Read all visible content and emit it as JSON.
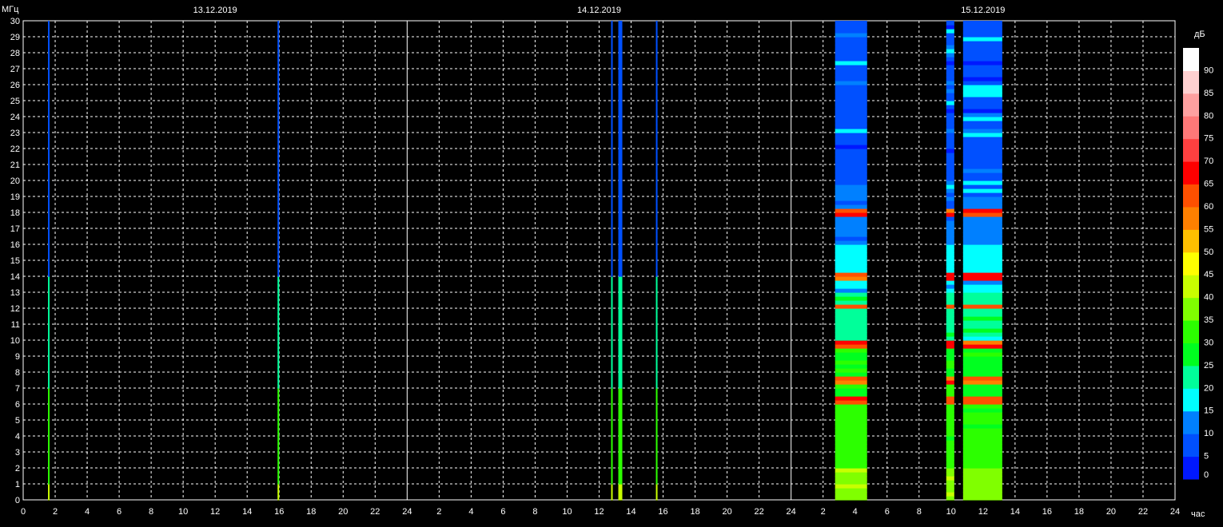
{
  "chart_data": {
    "type": "heatmap",
    "y_unit": "МГц",
    "x_unit": "час",
    "scale_unit": "дБ",
    "ylim": [
      0,
      30
    ],
    "xlim_hours": [
      0,
      72
    ],
    "dates": [
      "13.12.2019",
      "14.12.2019",
      "15.12.2019"
    ],
    "y_ticks": [
      0,
      1,
      2,
      3,
      4,
      5,
      6,
      7,
      8,
      9,
      10,
      11,
      12,
      13,
      14,
      15,
      16,
      17,
      18,
      19,
      20,
      21,
      22,
      23,
      24,
      25,
      26,
      27,
      28,
      29,
      30
    ],
    "x_tick_labels": [
      "0",
      "2",
      "4",
      "6",
      "8",
      "10",
      "12",
      "14",
      "16",
      "18",
      "20",
      "22",
      "24",
      "2",
      "4",
      "6",
      "8",
      "10",
      "12",
      "14",
      "16",
      "18",
      "20",
      "22",
      "24",
      "2",
      "4",
      "6",
      "8",
      "10",
      "12",
      "14",
      "16",
      "18",
      "20",
      "22",
      "24"
    ],
    "grid": true,
    "colorbar": {
      "ticks": [
        0,
        5,
        10,
        15,
        20,
        25,
        30,
        35,
        40,
        45,
        50,
        55,
        60,
        65,
        70,
        75,
        80,
        85,
        90
      ],
      "colors": [
        "#0018ff",
        "#0050ff",
        "#0080ff",
        "#00ffff",
        "#00ff9a",
        "#00ff20",
        "#2cff00",
        "#80ff00",
        "#c8ff00",
        "#ffff00",
        "#ffc000",
        "#ff8000",
        "#ff5000",
        "#ff0000",
        "#ff4040",
        "#ff7878",
        "#ffa0a0",
        "#ffd0d0",
        "#ffffff"
      ]
    },
    "observations": [
      {
        "start_h": 1.55,
        "end_h": 1.65,
        "type": "line"
      },
      {
        "start_h": 15.9,
        "end_h": 16.0,
        "type": "line"
      },
      {
        "start_h": 36.75,
        "end_h": 36.85,
        "type": "line"
      },
      {
        "start_h": 37.2,
        "end_h": 37.45,
        "type": "line"
      },
      {
        "start_h": 39.55,
        "end_h": 39.65,
        "type": "line"
      },
      {
        "start_h": 50.75,
        "end_h": 52.75,
        "type": "band"
      },
      {
        "start_h": 57.7,
        "end_h": 58.2,
        "type": "band"
      },
      {
        "start_h": 58.75,
        "end_h": 61.2,
        "type": "band"
      }
    ]
  }
}
